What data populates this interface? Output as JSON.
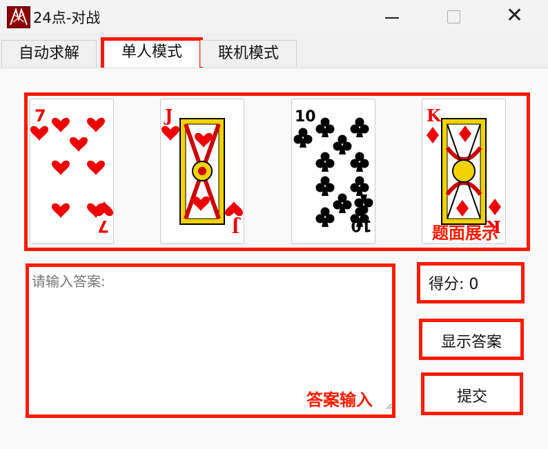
{
  "window": {
    "title": "24点-对战"
  },
  "tabs": [
    {
      "label": "自动求解"
    },
    {
      "label": "单人模式"
    },
    {
      "label": "联机模式"
    }
  ],
  "cards": [
    {
      "rank": "7",
      "suit": "hearts",
      "color": "#ff0000"
    },
    {
      "rank": "J",
      "suit": "hearts",
      "color": "#ff0000"
    },
    {
      "rank": "10",
      "suit": "clubs",
      "color": "#000000"
    },
    {
      "rank": "K",
      "suit": "diamonds",
      "color": "#ff0000"
    }
  ],
  "annotations": {
    "cards_label": "题面展示",
    "answer_label": "答案输入"
  },
  "answer": {
    "placeholder": "请输入答案:",
    "value": ""
  },
  "score": {
    "text": "得分: 0"
  },
  "buttons": {
    "show_answer": "显示答案",
    "submit": "提交"
  },
  "colors": {
    "highlight": "#ff1a00",
    "background": "#f0f0f0"
  }
}
